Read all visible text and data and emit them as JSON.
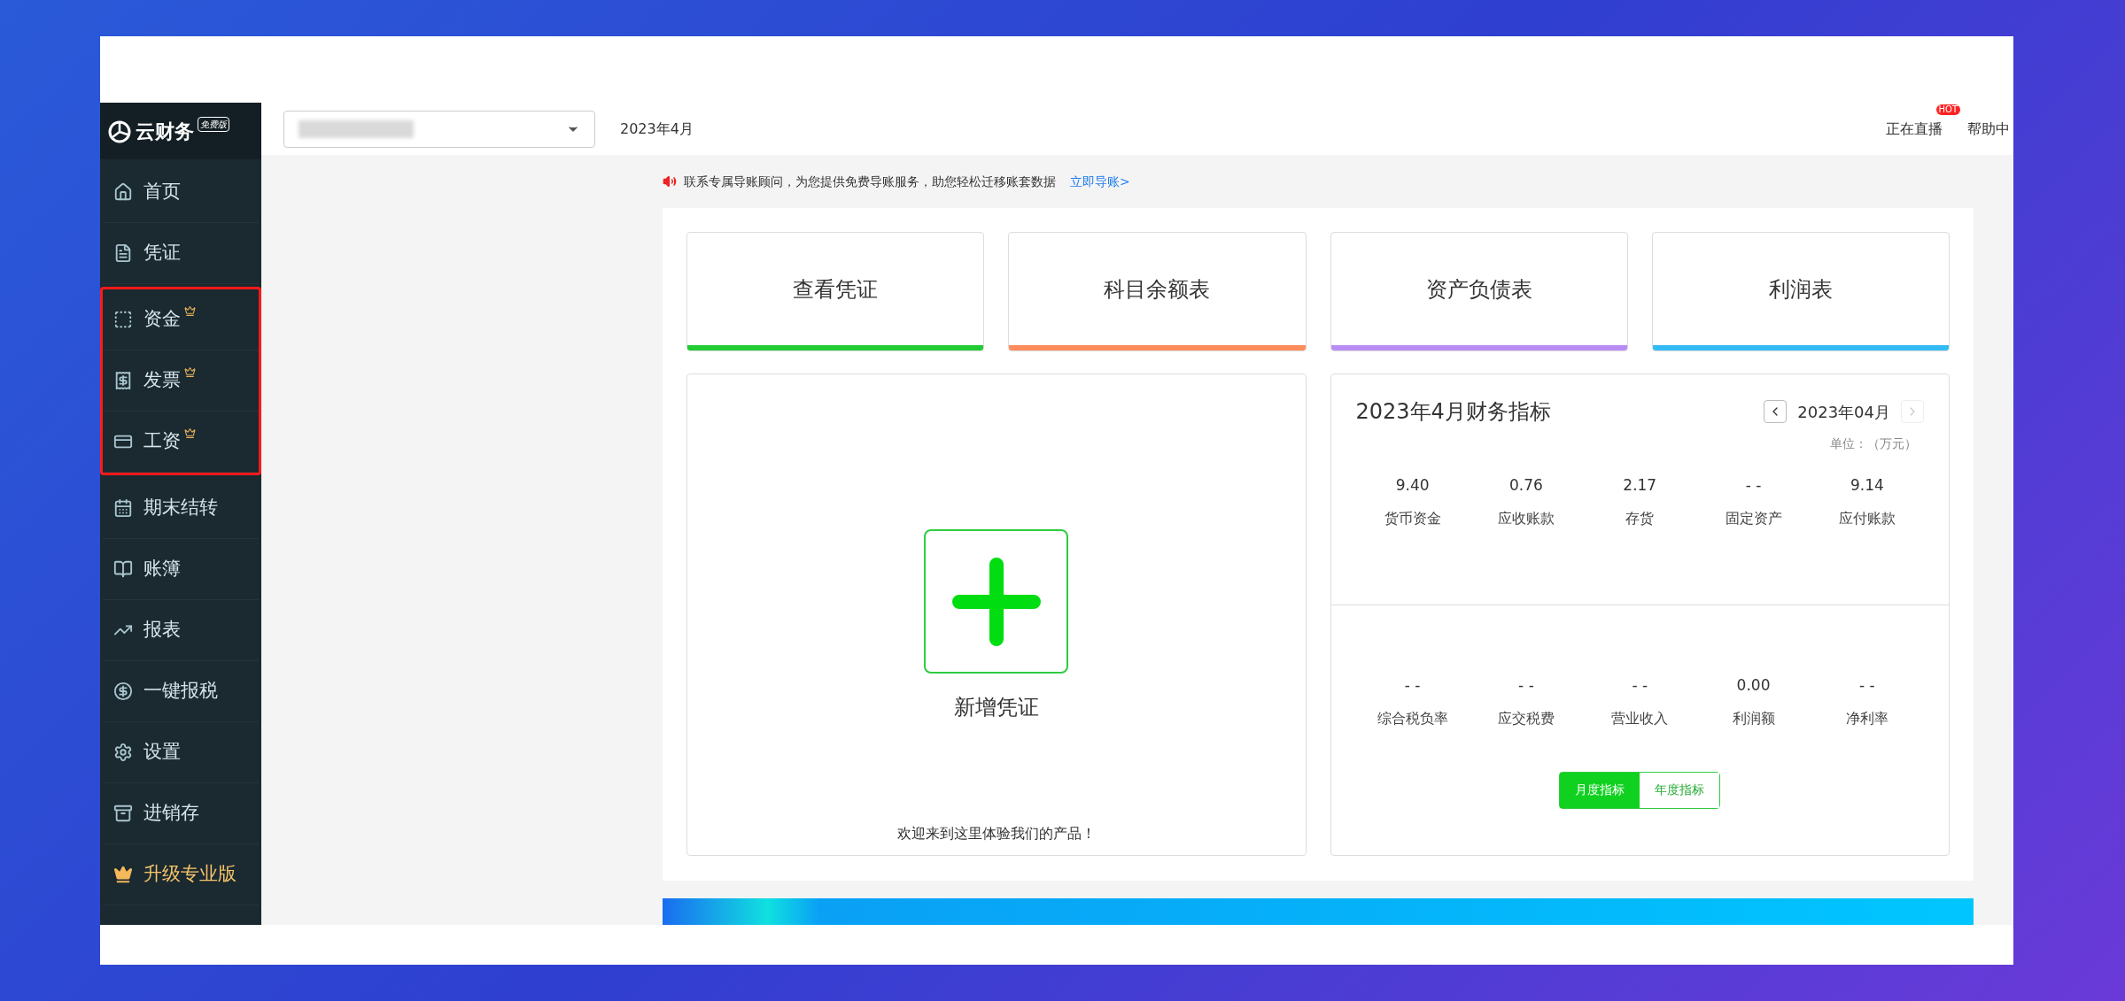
{
  "sidebar": {
    "logo": {
      "name": "云财务",
      "badge": "免费版"
    },
    "groups": [
      {
        "highlighted": false,
        "items": [
          {
            "label": "首页",
            "premium": false
          },
          {
            "label": "凭证",
            "premium": false
          }
        ]
      },
      {
        "highlighted": true,
        "items": [
          {
            "label": "资金",
            "premium": true
          },
          {
            "label": "发票",
            "premium": true
          },
          {
            "label": "工资",
            "premium": true
          }
        ]
      },
      {
        "highlighted": false,
        "items": [
          {
            "label": "期末结转",
            "premium": false
          },
          {
            "label": "账簿",
            "premium": false
          },
          {
            "label": "报表",
            "premium": false
          },
          {
            "label": "一键报税",
            "premium": false
          },
          {
            "label": "设置",
            "premium": false
          },
          {
            "label": "进销存",
            "premium": false
          },
          {
            "label": "升级专业版",
            "premium": false,
            "kind": "upgrade"
          }
        ]
      }
    ]
  },
  "header": {
    "period": "2023年4月",
    "links": [
      {
        "label": "正在直播",
        "badge": "HOT"
      },
      {
        "label": "帮助中"
      }
    ]
  },
  "notice": {
    "text": "联系专属导账顾问，为您提供免费导账服务，助您轻松迁移账套数据",
    "link": "立即导账>"
  },
  "shortcuts": [
    {
      "label": "查看凭证",
      "color": "#22cc33"
    },
    {
      "label": "科目余额表",
      "color": "#ff8c5a"
    },
    {
      "label": "资产负债表",
      "color": "#b98cf5"
    },
    {
      "label": "利润表",
      "color": "#33bbf5"
    }
  ],
  "new_voucher": {
    "label": "新增凭证",
    "welcome": "欢迎来到这里体验我们的产品！"
  },
  "indicators": {
    "title": "2023年4月财务指标",
    "month": "2023年04月",
    "unit": "单位：（万元）",
    "rows": [
      [
        {
          "value": "9.40",
          "label": "货币资金"
        },
        {
          "value": "0.76",
          "label": "应收账款"
        },
        {
          "value": "2.17",
          "label": "存货"
        },
        {
          "value": "- -",
          "label": "固定资产"
        },
        {
          "value": "9.14",
          "label": "应付账款"
        }
      ],
      [
        {
          "value": "- -",
          "label": "综合税负率"
        },
        {
          "value": "- -",
          "label": "应交税费"
        },
        {
          "value": "- -",
          "label": "营业收入"
        },
        {
          "value": "0.00",
          "label": "利润额"
        },
        {
          "value": "- -",
          "label": "净利率"
        }
      ]
    ],
    "tabs": [
      {
        "label": "月度指标",
        "selected": true
      },
      {
        "label": "年度指标",
        "selected": false
      }
    ]
  }
}
